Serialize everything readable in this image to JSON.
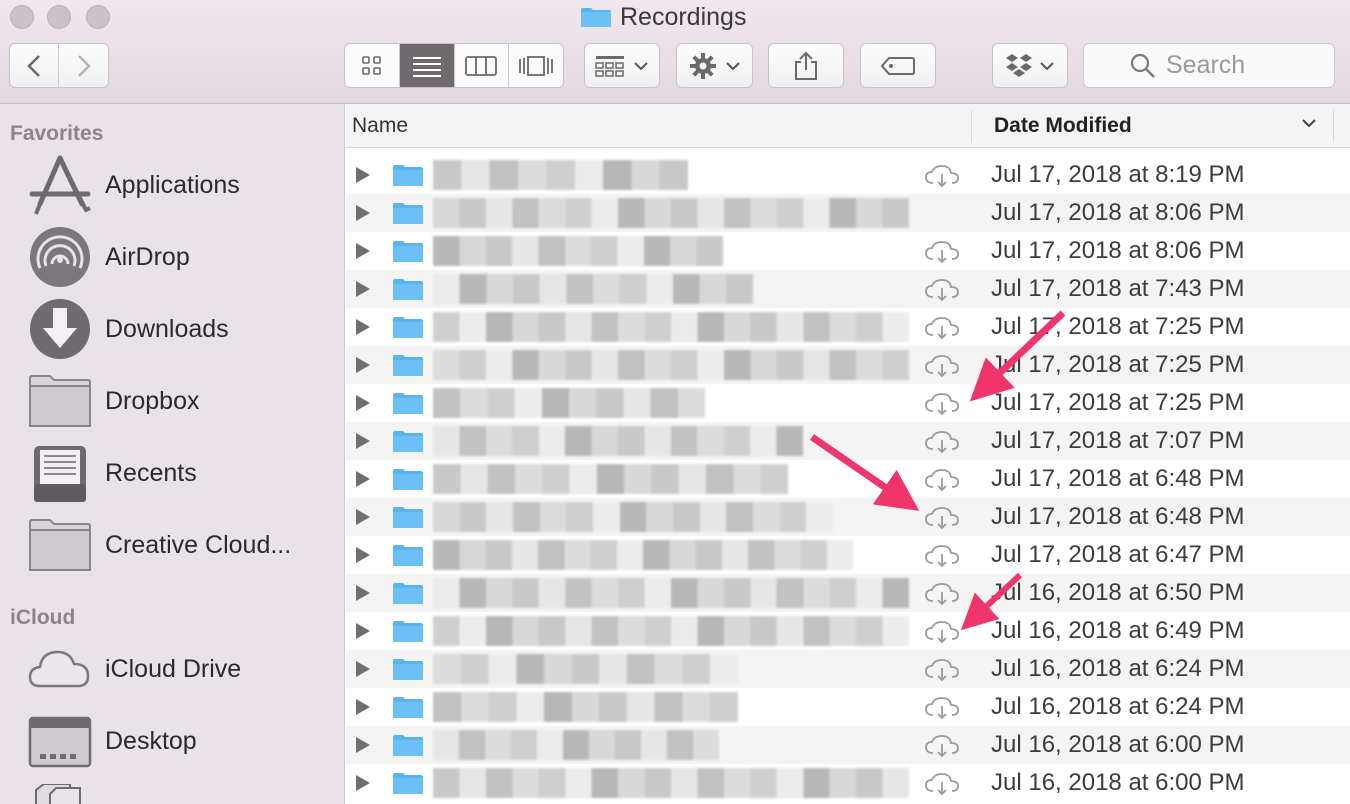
{
  "window": {
    "title": "Recordings",
    "toolbar": {
      "back_icon": "chevron-left-icon",
      "forward_icon": "chevron-right-icon",
      "view_modes": [
        "icon-view-icon",
        "list-view-icon",
        "column-view-icon",
        "cover-flow-icon"
      ],
      "active_view": "list",
      "group_icon": "group-by-icon",
      "action_icon": "gear-icon",
      "share_icon": "share-icon",
      "tag_icon": "tag-icon",
      "dropbox_icon": "dropbox-icon",
      "search_placeholder": "Search"
    }
  },
  "sidebar": {
    "sections": [
      {
        "title": "Favorites",
        "items": [
          {
            "label": "Applications",
            "icon": "applications-icon"
          },
          {
            "label": "AirDrop",
            "icon": "airdrop-icon"
          },
          {
            "label": "Downloads",
            "icon": "downloads-icon"
          },
          {
            "label": "Dropbox",
            "icon": "folder-icon"
          },
          {
            "label": "Recents",
            "icon": "recents-icon"
          },
          {
            "label": "Creative Cloud...",
            "icon": "folder-icon"
          }
        ]
      },
      {
        "title": "iCloud",
        "items": [
          {
            "label": "iCloud Drive",
            "icon": "cloud-icon"
          },
          {
            "label": "Desktop",
            "icon": "desktop-icon"
          }
        ]
      }
    ]
  },
  "list": {
    "columns": {
      "name": "Name",
      "date": "Date Modified"
    },
    "rows": [
      {
        "date": "Jul 17, 2018 at 8:19 PM",
        "cloud": true
      },
      {
        "date": "Jul 17, 2018 at 8:06 PM",
        "cloud": false
      },
      {
        "date": "Jul 17, 2018 at 8:06 PM",
        "cloud": true
      },
      {
        "date": "Jul 17, 2018 at 7:43 PM",
        "cloud": true
      },
      {
        "date": "Jul 17, 2018 at 7:25 PM",
        "cloud": true
      },
      {
        "date": "Jul 17, 2018 at 7:25 PM",
        "cloud": true
      },
      {
        "date": "Jul 17, 2018 at 7:25 PM",
        "cloud": true
      },
      {
        "date": "Jul 17, 2018 at 7:07 PM",
        "cloud": true
      },
      {
        "date": "Jul 17, 2018 at 6:48 PM",
        "cloud": true
      },
      {
        "date": "Jul 17, 2018 at 6:48 PM",
        "cloud": true
      },
      {
        "date": "Jul 17, 2018 at 6:47 PM",
        "cloud": true
      },
      {
        "date": "Jul 16, 2018 at 6:50 PM",
        "cloud": true
      },
      {
        "date": "Jul 16, 2018 at 6:49 PM",
        "cloud": true
      },
      {
        "date": "Jul 16, 2018 at 6:24 PM",
        "cloud": true
      },
      {
        "date": "Jul 16, 2018 at 6:24 PM",
        "cloud": true
      },
      {
        "date": "Jul 16, 2018 at 6:00 PM",
        "cloud": true
      },
      {
        "date": "Jul 16, 2018 at 6:00 PM",
        "cloud": true
      }
    ]
  },
  "colors": {
    "annotation_arrow": "#f0356b",
    "folder_blue": "#5ab4f0",
    "selected_segment": "#6e6a6e"
  }
}
